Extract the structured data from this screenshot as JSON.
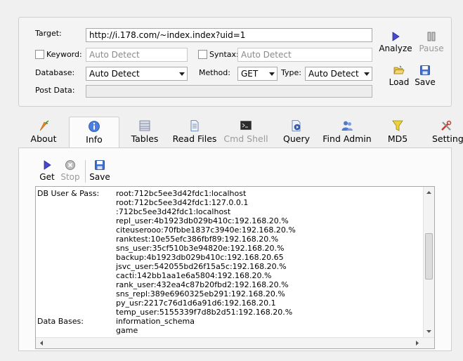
{
  "config": {
    "target_label": "Target:",
    "target_value": "http://i.178.com/~index.index?uid=1",
    "keyword_label": "Keyword:",
    "keyword_placeholder": "Auto Detect",
    "syntax_label": "Syntax:",
    "syntax_placeholder": "Auto Detect",
    "database_label": "Database:",
    "database_value": "Auto Detect",
    "method_label": "Method:",
    "method_value": "GET",
    "type_label": "Type:",
    "type_value": "Auto Detect",
    "postdata_label": "Post Data:"
  },
  "side_buttons": {
    "analyze": "Analyze",
    "pause": "Pause",
    "load": "Load",
    "save": "Save"
  },
  "tabs": [
    {
      "label": "About",
      "icon": "carrot-icon"
    },
    {
      "label": "Info",
      "icon": "info-icon"
    },
    {
      "label": "Tables",
      "icon": "table-icon"
    },
    {
      "label": "Read Files",
      "icon": "file-icon"
    },
    {
      "label": "Cmd Shell",
      "icon": "console-icon"
    },
    {
      "label": "Query",
      "icon": "query-icon"
    },
    {
      "label": "Find Admin",
      "icon": "users-icon"
    },
    {
      "label": "MD5",
      "icon": "funnel-icon"
    },
    {
      "label": "Settings",
      "icon": "tools-icon"
    }
  ],
  "toolbar": {
    "get": "Get",
    "stop": "Stop",
    "save": "Save"
  },
  "output": {
    "db_user_label": "DB User & Pass:",
    "db_users": [
      "root:712bc5ee3d42fdc1:localhost",
      "root:712bc5ee3d42fdc1:127.0.0.1",
      ":712bc5ee3d42fdc1:localhost",
      "repl_user:4b1923db029b410c:192.168.20.%",
      "citeuserooo:70fbbe1837c3940e:192.168.20.%",
      "ranktest:10e55efc386fbf89:192.168.20.%",
      "sns_user:35cf510b3e94820e:192.168.20.%",
      "backup:4b1923db029b410c:192.168.20.65",
      "jsvc_user:542055bd26f15a5c:192.168.20.%",
      "cacti:142bb1aa1e6a5804:192.168.20.%",
      "rank_user:432ea4c87b20fbd2:192.168.20.%",
      "sns_repl:389e6960325eb291:192.168.20.%",
      "py_usr:2217c76d1d6a91d6:192.168.20.1",
      "temp_user:5155339f7d8b2d51:192.168.20.%"
    ],
    "databases_label": "Data Bases:",
    "databases": [
      "information_schema",
      "game"
    ]
  },
  "colors": {
    "accent_blue": "#3c6fd6",
    "disabled_text": "#9a9a9a"
  }
}
